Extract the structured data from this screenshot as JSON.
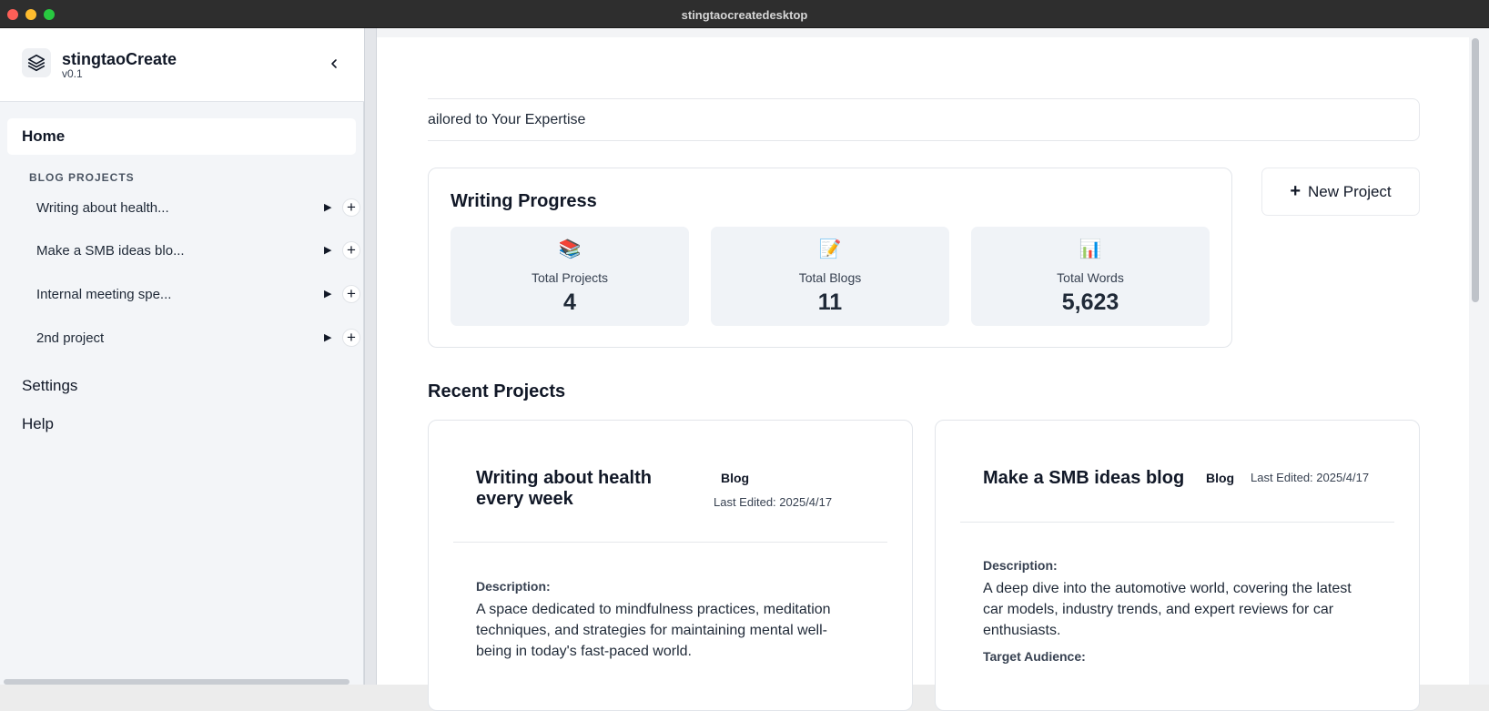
{
  "window": {
    "title": "stingtaocreatedesktop"
  },
  "brand": {
    "name": "stingtaoCreate",
    "version": "v0.1"
  },
  "sidebar": {
    "home_label": "Home",
    "section_label": "BLOG PROJECTS",
    "projects": [
      {
        "label": "Writing about health..."
      },
      {
        "label": "Make a SMB ideas blo..."
      },
      {
        "label": "Internal meeting spe..."
      },
      {
        "label": "2nd project"
      }
    ],
    "settings_label": "Settings",
    "help_label": "Help",
    "play_glyph": "▶",
    "add_glyph": "+"
  },
  "banner": {
    "text": "ailored to Your Expertise"
  },
  "progress": {
    "title": "Writing Progress",
    "stats": [
      {
        "icon": "📚",
        "label": "Total Projects",
        "value": "4"
      },
      {
        "icon": "📝",
        "label": "Total Blogs",
        "value": "11"
      },
      {
        "icon": "📊",
        "label": "Total Words",
        "value": "5,623"
      }
    ]
  },
  "new_project": {
    "plus": "+",
    "label": "New Project"
  },
  "recent": {
    "title": "Recent Projects",
    "cards": [
      {
        "title": "Writing about health every week",
        "badge": "Blog",
        "last_edited": "Last Edited: 2025/4/17",
        "desc_label": "Description:",
        "desc": "A space dedicated to mindfulness practices, meditation techniques, and strategies for maintaining mental well-being in today's fast-paced world."
      },
      {
        "title": "Make a SMB ideas blog",
        "badge": "Blog",
        "last_edited": "Last Edited: 2025/4/17",
        "desc_label": "Description:",
        "desc": "A deep dive into the automotive world, covering the latest car models, industry trends, and expert reviews for car enthusiasts.",
        "audience_label": "Target Audience:"
      }
    ]
  }
}
